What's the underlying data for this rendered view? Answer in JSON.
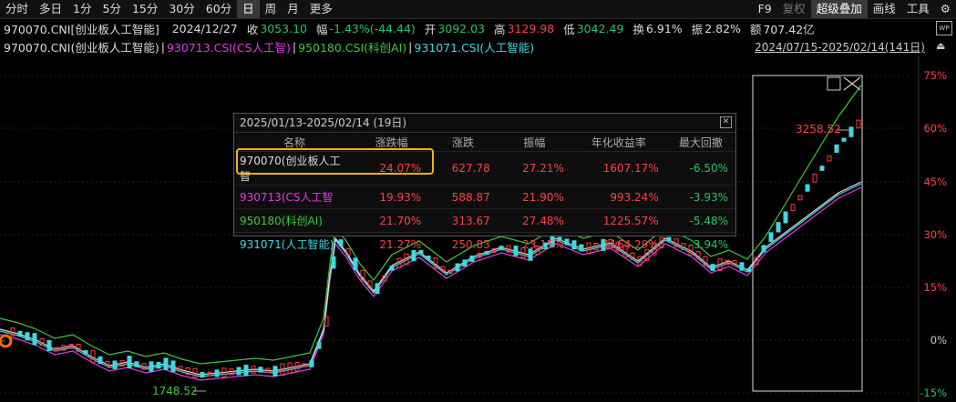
{
  "toolbar": {
    "timeframes": [
      "分时",
      "多日",
      "1分",
      "5分",
      "15分",
      "30分",
      "60分",
      "日",
      "周",
      "月",
      "更多"
    ],
    "active": "日",
    "right": [
      "F9",
      "复权",
      "超级叠加",
      "画线",
      "工具"
    ]
  },
  "info": {
    "symbol": "970070.CNI[创业板人工智能]",
    "date": "2024/12/27",
    "close_label": "收",
    "close": "3053.10",
    "change_label": "幅",
    "change": "-1.43%(-44.44)",
    "open_label": "开",
    "open": "3092.03",
    "high_label": "高",
    "high": "3129.98",
    "low_label": "低",
    "low": "3042.49",
    "turnover_label": "换",
    "turnover": "6.91%",
    "amp_label": "振",
    "amp": "2.82%",
    "amount_label": "额",
    "amount": "707.42亿",
    "wp_icon": "WP"
  },
  "legend": {
    "s1": "970070.CNI(创业板人工智能)",
    "sep": "|",
    "s2": "930713.CSI(CS人工智)",
    "s3": "950180.CSI(科创AI)",
    "s4": "931071.CSI(人工智能)",
    "range": "2024/07/15-2025/02/14(141日)"
  },
  "axis": {
    "ticks": [
      "75%",
      "60%",
      "45%",
      "30%",
      "15%",
      "0%",
      "-15%"
    ]
  },
  "annotations": {
    "high_val": "3258.52",
    "low_val": "1748.52"
  },
  "popup": {
    "title": "2025/01/13-2025/02/14 (19日)",
    "headers": [
      "名称",
      "涨跌幅",
      "涨跌",
      "振幅",
      "年化收益率",
      "最大回撤"
    ],
    "rows": [
      {
        "name": "970070(创业板人工智",
        "pct": "24.07%",
        "chg": "627.78",
        "amp": "27.21%",
        "annual": "1607.17%",
        "dd": "-6.50%"
      },
      {
        "name": "930713(CS人工智",
        "pct": "19.93%",
        "chg": "588.87",
        "amp": "21.90%",
        "annual": "993.24%",
        "dd": "-3.93%"
      },
      {
        "name": "950180(科创AI)",
        "pct": "21.70%",
        "chg": "313.67",
        "amp": "27.48%",
        "annual": "1225.57%",
        "dd": "-5.48%"
      },
      {
        "name": "931071(人工智能)",
        "pct": "21.27%",
        "chg": "250.83",
        "amp": "23.15%",
        "annual": "1164.29%",
        "dd": "-3.94%"
      }
    ]
  },
  "colors": {
    "up": "#ff4040",
    "down": "#22c55e",
    "green_line": "#3cc83c",
    "magenta": "#e23ae2",
    "cyan": "#3fd8e0",
    "highlight": "#f5b400"
  }
}
